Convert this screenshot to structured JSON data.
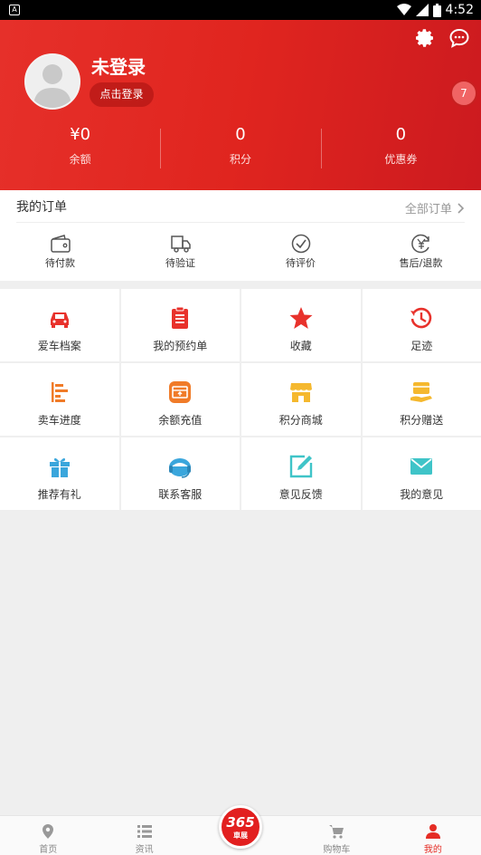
{
  "status_bar": {
    "time": "4:52"
  },
  "header": {
    "username": "未登录",
    "login_button": "点击登录",
    "float_badge": "7",
    "stats": [
      {
        "value": "¥0",
        "label": "余额"
      },
      {
        "value": "0",
        "label": "积分"
      },
      {
        "value": "0",
        "label": "优惠券"
      }
    ]
  },
  "orders": {
    "title": "我的订单",
    "all_link": "全部订单",
    "items": [
      {
        "label": "待付款",
        "icon": "wallet-icon"
      },
      {
        "label": "待验证",
        "icon": "truck-icon"
      },
      {
        "label": "待评价",
        "icon": "check-circle-icon"
      },
      {
        "label": "售后/退款",
        "icon": "yen-refund-icon"
      }
    ]
  },
  "grid": [
    {
      "label": "爱车档案",
      "icon": "car-icon",
      "color": "#e8322c"
    },
    {
      "label": "我的预约单",
      "icon": "clipboard-icon",
      "color": "#e8322c"
    },
    {
      "label": "收藏",
      "icon": "star-icon",
      "color": "#e8322c"
    },
    {
      "label": "足迹",
      "icon": "history-icon",
      "color": "#e8322c"
    },
    {
      "label": "卖车进度",
      "icon": "progress-bars-icon",
      "color": "#f07b28"
    },
    {
      "label": "余额充值",
      "icon": "recharge-icon",
      "color": "#f07b28"
    },
    {
      "label": "积分商城",
      "icon": "store-icon",
      "color": "#f5b82e"
    },
    {
      "label": "积分赠送",
      "icon": "gift-card-hand-icon",
      "color": "#f5b82e"
    },
    {
      "label": "推荐有礼",
      "icon": "gift-icon",
      "color": "#3aa6dc"
    },
    {
      "label": "联系客服",
      "icon": "headset-icon",
      "color": "#3aa6dc"
    },
    {
      "label": "意见反馈",
      "icon": "edit-icon",
      "color": "#3fc4c8"
    },
    {
      "label": "我的意见",
      "icon": "mail-icon",
      "color": "#3fc4c8"
    }
  ],
  "tabbar": {
    "items": [
      {
        "label": "首页",
        "icon": "location-pin-icon"
      },
      {
        "label": "资讯",
        "icon": "list-icon"
      },
      {
        "label": "",
        "icon": "365-logo"
      },
      {
        "label": "购物车",
        "icon": "cart-icon"
      },
      {
        "label": "我的",
        "icon": "person-icon"
      }
    ],
    "center_logo": {
      "big": "365",
      "small": "車展"
    },
    "active_color": "#e52c24"
  }
}
